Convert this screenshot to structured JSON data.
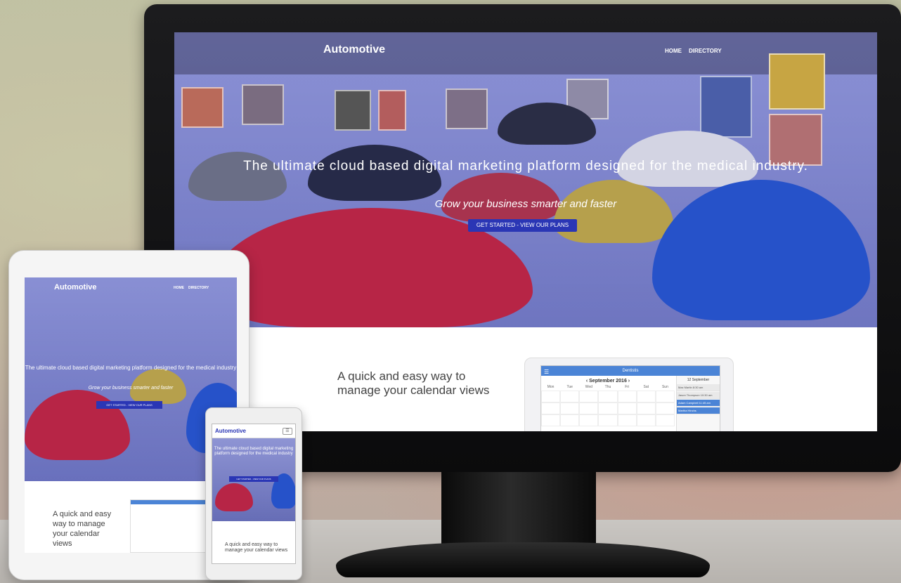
{
  "desktop": {
    "logo": "Automotive",
    "nav": [
      "HOME",
      "DIRECTORY"
    ],
    "hero_title": "The ultimate cloud based digital marketing platform designed for the medical industry.",
    "hero_subtitle": "Grow your business smarter and faster",
    "cta": "GET STARTED - VIEW OUR PLANS",
    "section_text": "A quick and easy way to manage your calendar views",
    "calendar": {
      "app_title": "Dentistis",
      "month": "September 2016",
      "weekdays": [
        "Mon",
        "Tue",
        "Wed",
        "Thu",
        "Fri",
        "Sat",
        "Sun"
      ],
      "side_title": "12 September",
      "events": [
        "Max Martin",
        "Jason Thompson",
        "Adam Campbell",
        "Martha Hinchs"
      ],
      "event_times": [
        "8:30 am",
        "10:30 am",
        "11:45 am",
        ""
      ]
    }
  },
  "tablet": {
    "logo": "Automotive",
    "nav": [
      "HOME",
      "DIRECTORY"
    ],
    "hero_title": "The ultimate cloud based digital marketing platform designed for the medical industry",
    "hero_subtitle": "Grow your business smarter and faster",
    "cta": "GET STARTED - VIEW OUR PLANS",
    "section_text": "A quick and easy way to manage your calendar views"
  },
  "phone": {
    "logo": "Automotive",
    "hero_title": "The ultimate cloud based digital marketing platform designed for the medical industry",
    "cta": "GET STARTED - VIEW OUR PLANS",
    "section_text": "A quick and easy way to manage your calendar views"
  }
}
